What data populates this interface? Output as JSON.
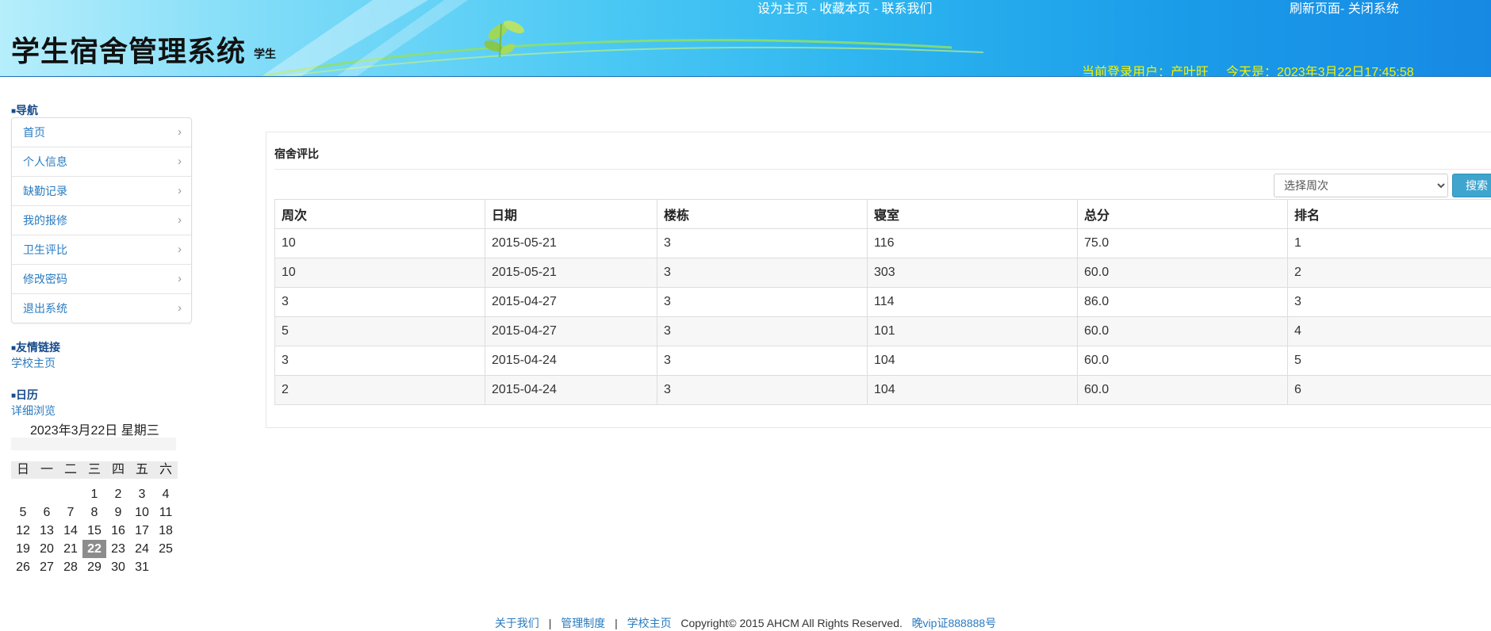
{
  "header": {
    "system_title": "学生宿舍管理系统",
    "role": "学生",
    "top_links": {
      "set_home": "设为主页",
      "bookmark": "收藏本页",
      "contact": "联系我们",
      "sep": " - "
    },
    "right_links": {
      "refresh": "刷新页面",
      "close": "关闭系统",
      "sep": "- "
    },
    "current_user_label": "当前登录用户：",
    "current_user": "产叶旺",
    "today_label": "今天是：",
    "today_value": "2023年3月22日17:45:58"
  },
  "sidebar": {
    "nav_heading": "导航",
    "nav_items": [
      {
        "label": "首页"
      },
      {
        "label": "个人信息"
      },
      {
        "label": "缺勤记录"
      },
      {
        "label": "我的报修"
      },
      {
        "label": "卫生评比"
      },
      {
        "label": "修改密码"
      },
      {
        "label": "退出系统"
      }
    ],
    "links_heading": "友情链接",
    "school_link": "学校主页",
    "calendar_heading": "日历",
    "calendar_detail": "详细浏览",
    "calendar": {
      "title": "2023年3月22日 星期三",
      "weekdays": [
        "日",
        "一",
        "二",
        "三",
        "四",
        "五",
        "六"
      ],
      "weeks": [
        [
          "",
          "",
          "",
          "1",
          "2",
          "3",
          "4"
        ],
        [
          "5",
          "6",
          "7",
          "8",
          "9",
          "10",
          "11"
        ],
        [
          "12",
          "13",
          "14",
          "15",
          "16",
          "17",
          "18"
        ],
        [
          "19",
          "20",
          "21",
          "22",
          "23",
          "24",
          "25"
        ],
        [
          "26",
          "27",
          "28",
          "29",
          "30",
          "31",
          ""
        ]
      ],
      "today": "22"
    }
  },
  "main": {
    "panel_title": "宿舍评比",
    "select_placeholder": "选择周次",
    "search_label": "搜索",
    "columns": [
      "周次",
      "日期",
      "楼栋",
      "寝室",
      "总分",
      "排名"
    ],
    "rows": [
      [
        "10",
        "2015-05-21",
        "3",
        "116",
        "75.0",
        "1"
      ],
      [
        "10",
        "2015-05-21",
        "3",
        "303",
        "60.0",
        "2"
      ],
      [
        "3",
        "2015-04-27",
        "3",
        "114",
        "86.0",
        "3"
      ],
      [
        "5",
        "2015-04-27",
        "3",
        "101",
        "60.0",
        "4"
      ],
      [
        "3",
        "2015-04-24",
        "3",
        "104",
        "60.0",
        "5"
      ],
      [
        "2",
        "2015-04-24",
        "3",
        "104",
        "60.0",
        "6"
      ]
    ]
  },
  "footer": {
    "about": "关于我们",
    "rules": "管理制度",
    "school": "学校主页",
    "divider": "|",
    "copyright": "Copyright© 2015 AHCM All Rights Reserved.",
    "license": "晚vip证888888号"
  },
  "colors": {
    "link": "#2a7bc0",
    "heading": "#174b8a",
    "user_info": "#f5f200",
    "search_button": "#3fa5cf"
  }
}
